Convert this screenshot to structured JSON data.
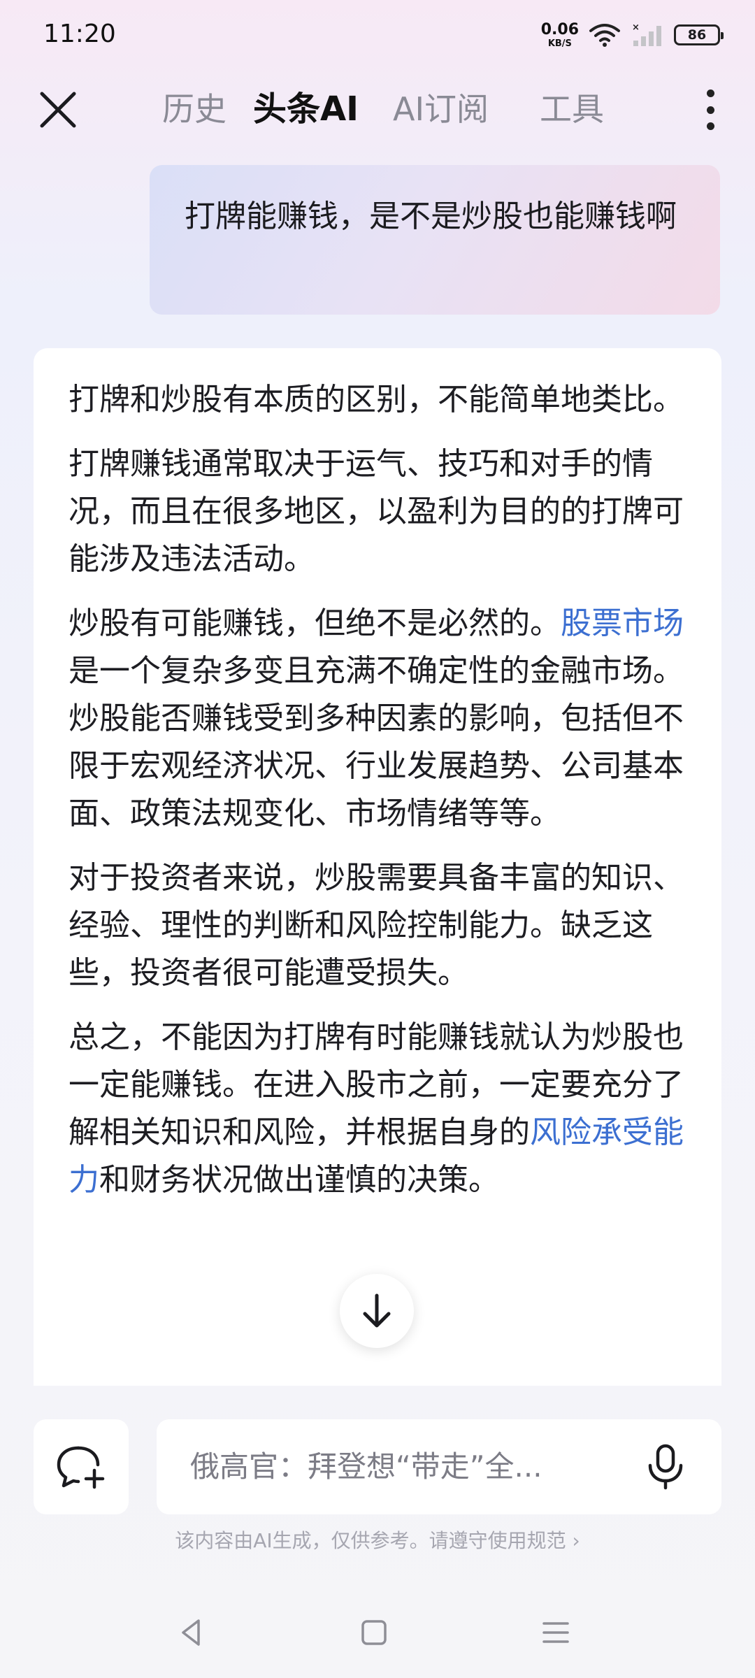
{
  "status_bar": {
    "time": "11:20",
    "net_speed_value": "0.06",
    "net_speed_unit": "KB/S",
    "battery": "86"
  },
  "nav": {
    "tabs": [
      {
        "label": "历史"
      },
      {
        "label": "头条AI"
      },
      {
        "label": "AI订阅"
      },
      {
        "label": "工具"
      }
    ],
    "active_tab": "头条AI"
  },
  "conversation": {
    "user_message": "打牌能赚钱，是不是炒股也能赚钱啊",
    "answer": {
      "p1": "打牌和炒股有本质的区别，不能简单地类比。",
      "p2": "打牌赚钱通常取决于运气、技巧和对手的情况，而且在很多地区，以盈利为目的的打牌可能涉及违法活动。",
      "p3_before": "炒股有可能赚钱，但绝不是必然的。",
      "p3_link": "股票市场",
      "p3_after": "是一个复杂多变且充满不确定性的金融市场。炒股能否赚钱受到多种因素的影响，包括但不限于宏观经济状况、行业发展趋势、公司基本面、政策法规变化、市场情绪等等。",
      "p4": "对于投资者来说，炒股需要具备丰富的知识、经验、理性的判断和风险控制能力。缺乏这些，投资者很可能遭受损失。",
      "p5_before": "总之，不能因为打牌有时能赚钱就认为炒股也一定能赚钱。在进入股市之前，一定要充分了解相关知识和风险，并根据自身的",
      "p5_link": "风险承受能力",
      "p5_after": "和财务状况做出谨慎的决策。"
    }
  },
  "input": {
    "placeholder": "俄高官：拜登想“带走”全..."
  },
  "disclaimer": "该内容由AI生成，仅供参考。请遵守使用规范 ›",
  "colors": {
    "link": "#3c6fd1",
    "text": "#1d1d22",
    "inactive_tab": "#8a8a95"
  }
}
